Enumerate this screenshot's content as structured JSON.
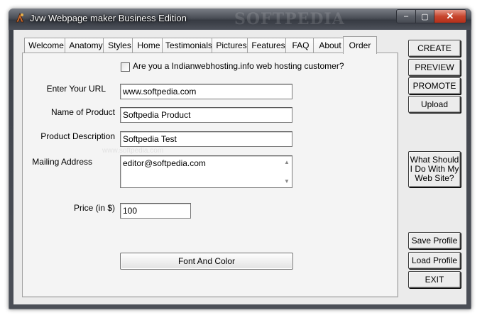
{
  "window": {
    "title": "Jvw Webpage maker Business Edition",
    "watermark": "SOFTPEDIA",
    "controls": {
      "minimize": "‒",
      "maximize": "▢",
      "close": "✕"
    }
  },
  "tabs": [
    {
      "label": "Welcome",
      "active": false
    },
    {
      "label": "Anatomy",
      "active": false
    },
    {
      "label": "Styles",
      "active": false
    },
    {
      "label": "Home",
      "active": false
    },
    {
      "label": "Testimonials",
      "active": false
    },
    {
      "label": "Pictures",
      "active": false
    },
    {
      "label": "Features",
      "active": false
    },
    {
      "label": "FAQ",
      "active": false
    },
    {
      "label": "About",
      "active": false
    },
    {
      "label": "Order",
      "active": true
    }
  ],
  "order_form": {
    "hosting_checkbox_label": "Are you a Indianwebhosting.info web hosting customer?",
    "hosting_checked": false,
    "url_label": "Enter Your URL",
    "url_value": "www.softpedia.com",
    "product_name_label": "Name of Product",
    "product_name_value": "Softpedia Product",
    "product_desc_label": "Product Description",
    "product_desc_value": "Softpedia Test",
    "mailing_label": "Mailing Address",
    "mailing_value": "editor@softpedia.com",
    "price_label": "Price (in $)",
    "price_value": "100",
    "font_color_button": "Font And Color"
  },
  "sidebar": {
    "create": "CREATE",
    "preview": "PREVIEW",
    "promote": "PROMOTE",
    "upload": "Upload",
    "what_should_line1": "What Should",
    "what_should_line2": "I Do With My",
    "what_should_line3": "Web Site?",
    "save_profile": "Save Profile",
    "load_profile": "Load Profile",
    "exit": "EXIT"
  },
  "faint_watermark": "www.softpedia.com"
}
